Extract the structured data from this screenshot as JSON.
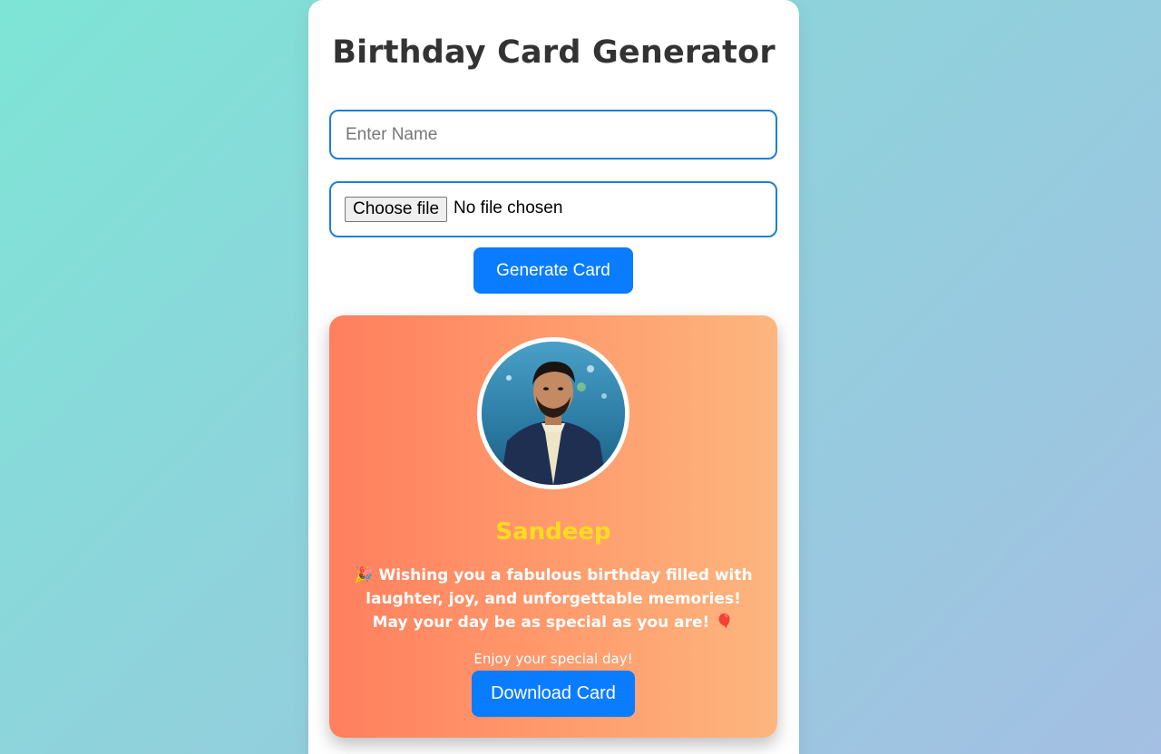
{
  "page": {
    "title": "Birthday Card Generator"
  },
  "form": {
    "name_placeholder": "Enter Name",
    "name_value": "",
    "file_button_label": "Choose file",
    "file_status": "No file chosen",
    "generate_label": "Generate Card"
  },
  "card": {
    "name": "Sandeep",
    "message": "🎉 Wishing you a fabulous birthday filled with laughter, joy, and unforgettable memories! May your day be as special as you are! 🎈",
    "footer": "Enjoy your special day!",
    "download_label": "Download Card",
    "photo_icon": "person-photo"
  },
  "colors": {
    "accent": "#0a7cff",
    "input_border": "#1e7fd6",
    "card_gradient_start": "#ff7f5e",
    "card_gradient_end": "#fdb67f",
    "name_color": "#ffdc1e"
  }
}
